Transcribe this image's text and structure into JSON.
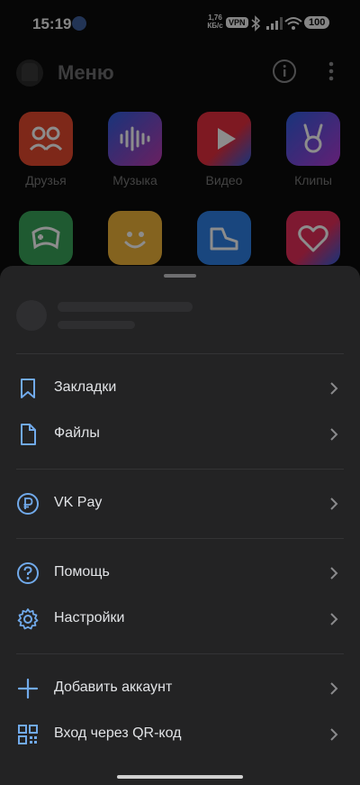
{
  "status_bar": {
    "time": "15:19",
    "speed_value": "1,76",
    "speed_unit": "КБ/с",
    "vpn": "VPN",
    "battery": "100"
  },
  "header": {
    "title": "Меню"
  },
  "apps": [
    {
      "label": "Друзья",
      "color": "#e64a2e"
    },
    {
      "label": "Музыка",
      "color": "#b43ab8"
    },
    {
      "label": "Видео",
      "color": "#e62e3e"
    },
    {
      "label": "Клипы",
      "color": "#8a3ad6"
    },
    {
      "label": "",
      "color": "#3aa45a"
    },
    {
      "label": "",
      "color": "#f0b43a"
    },
    {
      "label": "",
      "color": "#2e80e6"
    },
    {
      "label": "",
      "color": "#e62e5a"
    }
  ],
  "menu": {
    "bookmarks": "Закладки",
    "files": "Файлы",
    "vkpay": "VK Pay",
    "help": "Помощь",
    "settings": "Настройки",
    "add_account": "Добавить аккаунт",
    "qr_login": "Вход через QR-код"
  },
  "colors": {
    "accent": "#71aaeb",
    "sheet_bg": "#232324",
    "text": "#e1e3e6"
  }
}
